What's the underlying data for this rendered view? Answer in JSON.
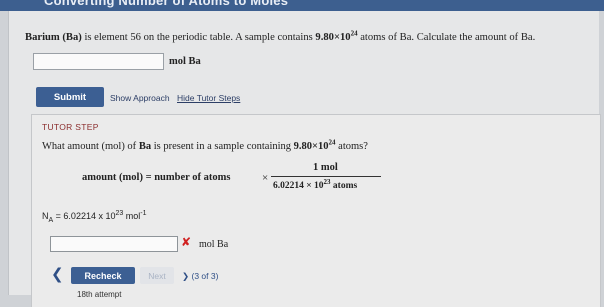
{
  "header": {
    "title": "Converting Number of Atoms to Moles"
  },
  "question": {
    "element_bold": "Barium (Ba)",
    "text_part1": " is element 56 on the periodic table. A sample contains ",
    "amount_base": "9.80×10",
    "amount_exp": "24",
    "text_part2": " atoms of Ba. Calculate the amount of Ba.",
    "answer_value": "",
    "unit": "mol Ba"
  },
  "actions": {
    "submit": "Submit",
    "show_approach": "Show Approach",
    "hide_tutor_steps": "Hide Tutor Steps"
  },
  "tutor": {
    "heading": "TUTOR STEP",
    "question_part1": "What amount (mol) of ",
    "question_bold": "Ba",
    "question_part2": " is present in a sample containing ",
    "question_amount_base": "9.80×10",
    "question_amount_exp": "24",
    "question_part3": " atoms?",
    "equation_left": "amount (mol) = number of atoms",
    "times": "×",
    "numerator": "1 mol",
    "denominator_base": "6.02214 × 10",
    "denominator_exp": "23",
    "denominator_unit": " atoms",
    "avogadro_label": "N",
    "avogadro_sub": "A",
    "avogadro_eq": " = 6.02214 x 10",
    "avogadro_exp": "23",
    "avogadro_unit": " mol",
    "avogadro_unit_exp": "-1",
    "answer_value": "",
    "answer_status": "incorrect",
    "unit": "mol Ba",
    "recheck": "Recheck",
    "next": "Next",
    "progress": "(3 of 3)",
    "attempt": "18th attempt"
  },
  "colors": {
    "button_primary": "#3c5f93",
    "tutor_heading": "#8b2e2e",
    "error": "#d02020"
  },
  "icons": {
    "incorrect": "x-mark-icon",
    "back": "chevron-left-icon",
    "forward": "chevron-right-icon"
  }
}
